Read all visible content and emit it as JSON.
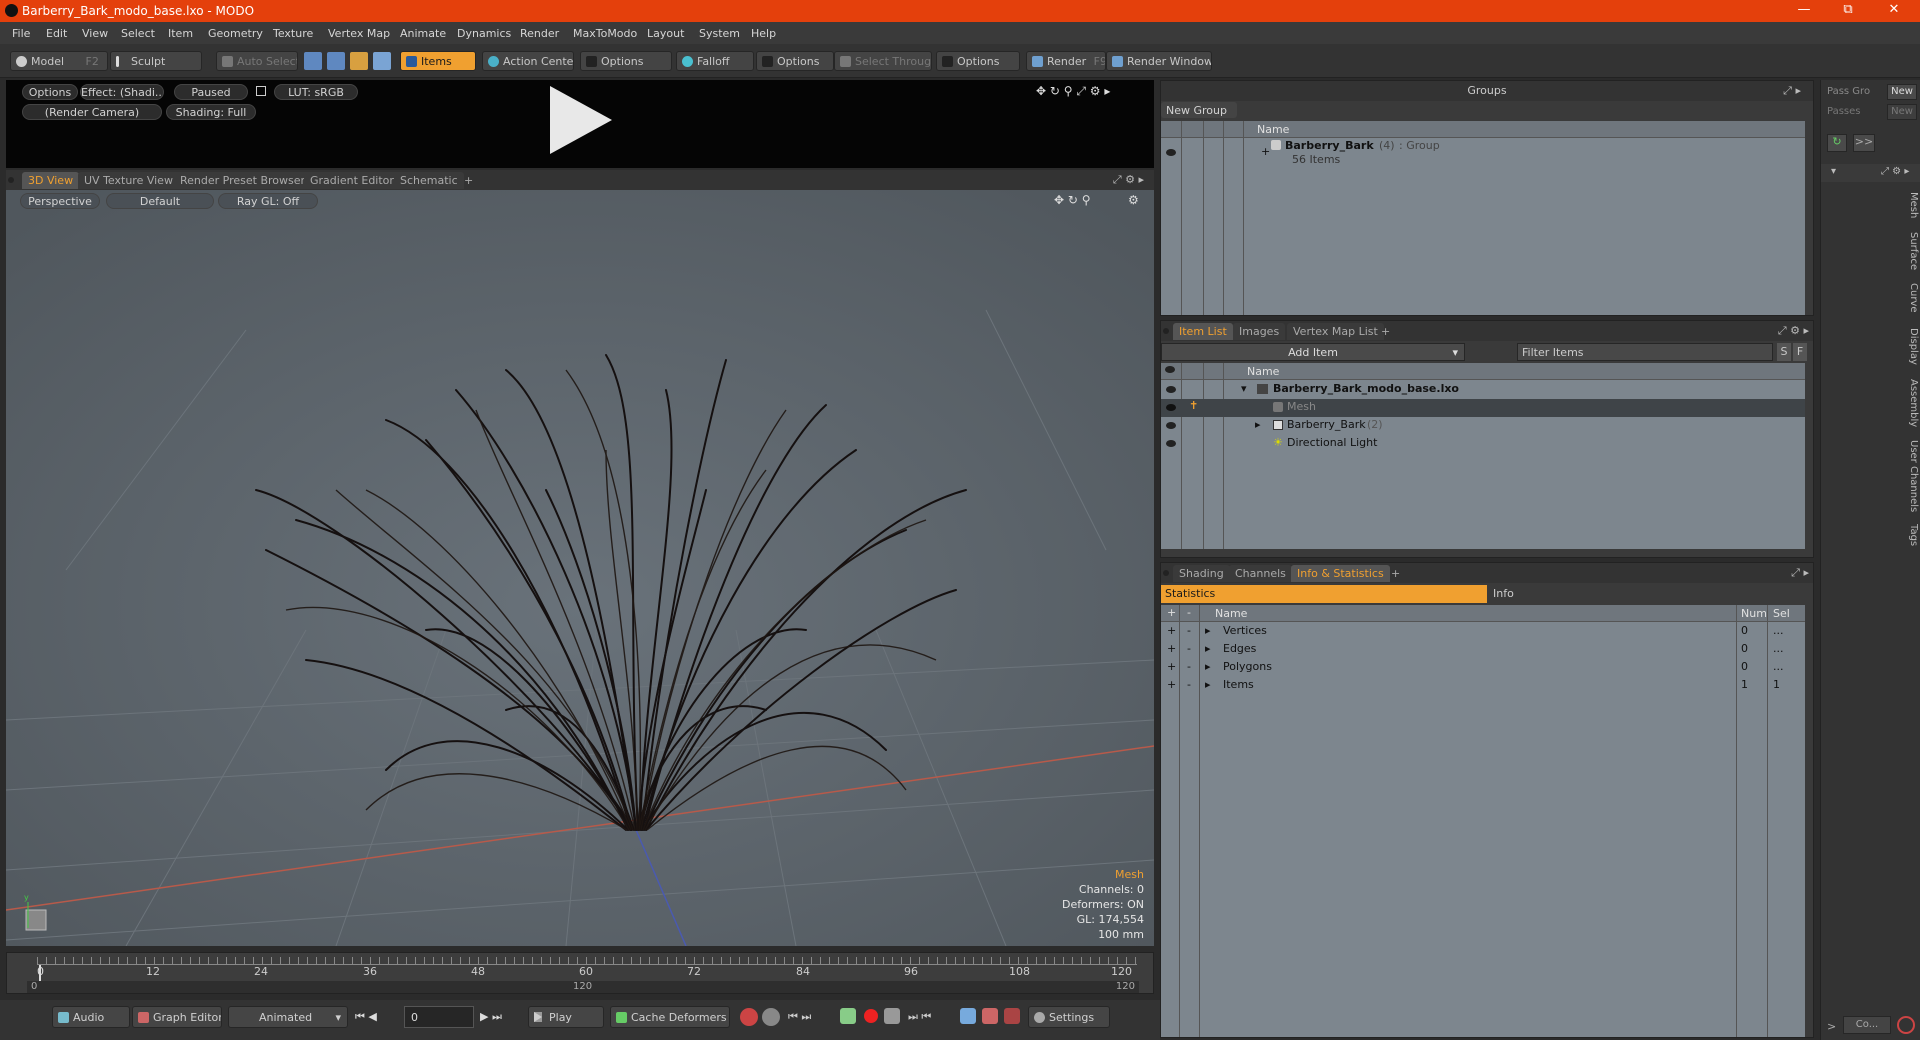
{
  "window": {
    "title": "Barberry_Bark_modo_base.lxo - MODO"
  },
  "menu": [
    "File",
    "Edit",
    "View",
    "Select",
    "Item",
    "Geometry",
    "Texture",
    "Vertex Map",
    "Animate",
    "Dynamics",
    "Render",
    "MaxToModo",
    "Layout",
    "System",
    "Help"
  ],
  "toolbar": {
    "model": "Model",
    "model_key": "F2",
    "sculpt": "Sculpt",
    "auto_select": "Auto Select",
    "items": "Items",
    "action_center": "Action Center",
    "options1": "Options",
    "falloff": "Falloff",
    "options2": "Options",
    "select_through": "Select Through",
    "options3": "Options",
    "render": "Render",
    "render_key": "F9",
    "render_window": "Render Window"
  },
  "preview": {
    "options": "Options",
    "effect": "Effect: (Shadi...",
    "paused": "Paused",
    "lut": "LUT: sRGB",
    "camera": "(Render Camera)",
    "shading": "Shading: Full"
  },
  "viewport_tabs": [
    "3D View",
    "UV Texture View",
    "Render Preset Browser",
    "Gradient Editor",
    "Schematic",
    "+"
  ],
  "viewport": {
    "perspective": "Perspective",
    "default": "Default",
    "raygl": "Ray GL: Off",
    "info_title": "Mesh",
    "channels": "Channels: 0",
    "deformers": "Deformers: ON",
    "gl": "GL: 174,554",
    "scale": "100 mm"
  },
  "timeline": {
    "ticks": [
      "0",
      "12",
      "24",
      "36",
      "48",
      "60",
      "72",
      "84",
      "96",
      "108",
      "120"
    ],
    "range_start": "0",
    "range_mid": "120",
    "range_end": "120"
  },
  "bottombar": {
    "audio": "Audio",
    "graph_editor": "Graph Editor",
    "animated": "Animated",
    "frame": "0",
    "play": "Play",
    "cache": "Cache Deformers",
    "settings": "Settings"
  },
  "groups": {
    "title": "Groups",
    "new_group": "New Group",
    "col_name": "Name",
    "group_name": "Barberry_Bark",
    "group_count": "(4)",
    "group_type": ": Group",
    "group_items": "56 Items"
  },
  "pass": {
    "pass_groups": "Pass Gro",
    "passes": "Passes",
    "new1": "New",
    "new2": "New"
  },
  "items_tabs": [
    "Item List",
    "Images",
    "Vertex Map List",
    "+"
  ],
  "item_list": {
    "add_item": "Add Item",
    "filter": "Filter Items",
    "s": "S",
    "f": "F",
    "col_name": "Name",
    "rows": [
      {
        "name": "Barberry_Bark_modo_base.lxo",
        "extra": ""
      },
      {
        "name": "Mesh",
        "extra": ""
      },
      {
        "name": "Barberry_Bark",
        "extra": "(2)"
      },
      {
        "name": "Directional Light",
        "extra": ""
      }
    ]
  },
  "stats_tabs": [
    "Shading",
    "Channels",
    "Info & Statistics",
    "+"
  ],
  "statistics": {
    "statistics_label": "Statistics",
    "info_label": "Info",
    "col_name": "Name",
    "col_num": "Num",
    "col_sel": "Sel",
    "rows": [
      {
        "name": "Vertices",
        "num": "0",
        "sel": "..."
      },
      {
        "name": "Edges",
        "num": "0",
        "sel": "..."
      },
      {
        "name": "Polygons",
        "num": "0",
        "sel": "..."
      },
      {
        "name": "Items",
        "num": "1",
        "sel": "1"
      }
    ]
  },
  "side_tabs": [
    "Mesh",
    "Surface",
    "Curve",
    "Display",
    "Assembly",
    "User Channels",
    "Tags"
  ],
  "side_bottom": "Co..."
}
